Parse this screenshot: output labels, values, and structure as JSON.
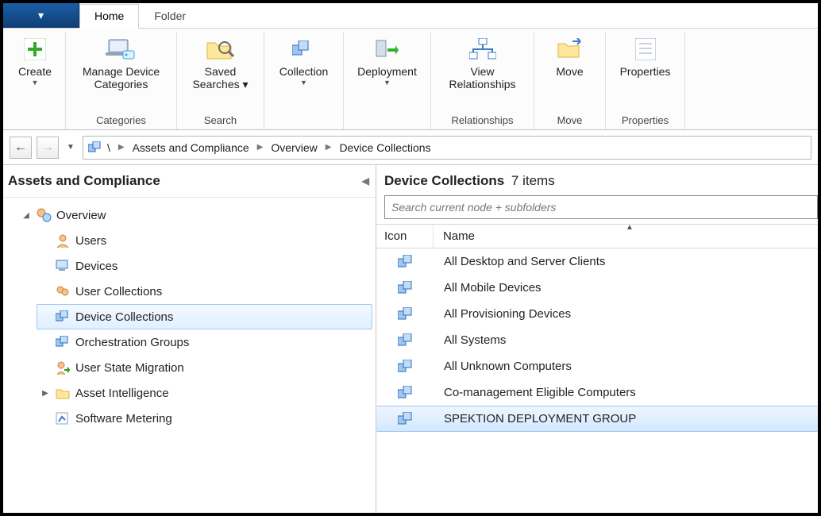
{
  "tabs": {
    "menu": "▾",
    "home": "Home",
    "folder": "Folder"
  },
  "ribbon": {
    "create": {
      "label": "Create",
      "group": ""
    },
    "categories": {
      "label": "Manage Device\nCategories",
      "group": "Categories"
    },
    "search": {
      "label": "Saved\nSearches ▾",
      "group": "Search"
    },
    "collection": {
      "label": "Collection",
      "group": ""
    },
    "deployment": {
      "label": "Deployment",
      "group": ""
    },
    "relationships": {
      "label": "View\nRelationships",
      "group": "Relationships"
    },
    "move": {
      "label": "Move",
      "group": "Move"
    },
    "properties": {
      "label": "Properties",
      "group": "Properties"
    }
  },
  "breadcrumb": {
    "root": "\\",
    "seg1": "Assets and Compliance",
    "seg2": "Overview",
    "seg3": "Device Collections"
  },
  "leftpane": {
    "title": "Assets and Compliance",
    "nodes": {
      "overview": "Overview",
      "users": "Users",
      "devices": "Devices",
      "user_collections": "User Collections",
      "device_collections": "Device Collections",
      "orchestration": "Orchestration Groups",
      "user_state": "User State Migration",
      "asset_intel": "Asset Intelligence",
      "software_metering": "Software Metering"
    }
  },
  "rightpane": {
    "title": "Device Collections",
    "count_label": "7 items",
    "search_placeholder": "Search current node + subfolders",
    "columns": {
      "icon": "Icon",
      "name": "Name"
    },
    "rows": [
      {
        "name": "All Desktop and Server Clients",
        "selected": false
      },
      {
        "name": "All Mobile Devices",
        "selected": false
      },
      {
        "name": "All Provisioning Devices",
        "selected": false
      },
      {
        "name": "All Systems",
        "selected": false
      },
      {
        "name": "All Unknown Computers",
        "selected": false
      },
      {
        "name": "Co-management Eligible Computers",
        "selected": false
      },
      {
        "name": "SPEKTION DEPLOYMENT GROUP",
        "selected": true
      }
    ]
  },
  "colors": {
    "accent": "#1a5da2",
    "selection": "#d3e8ff"
  }
}
